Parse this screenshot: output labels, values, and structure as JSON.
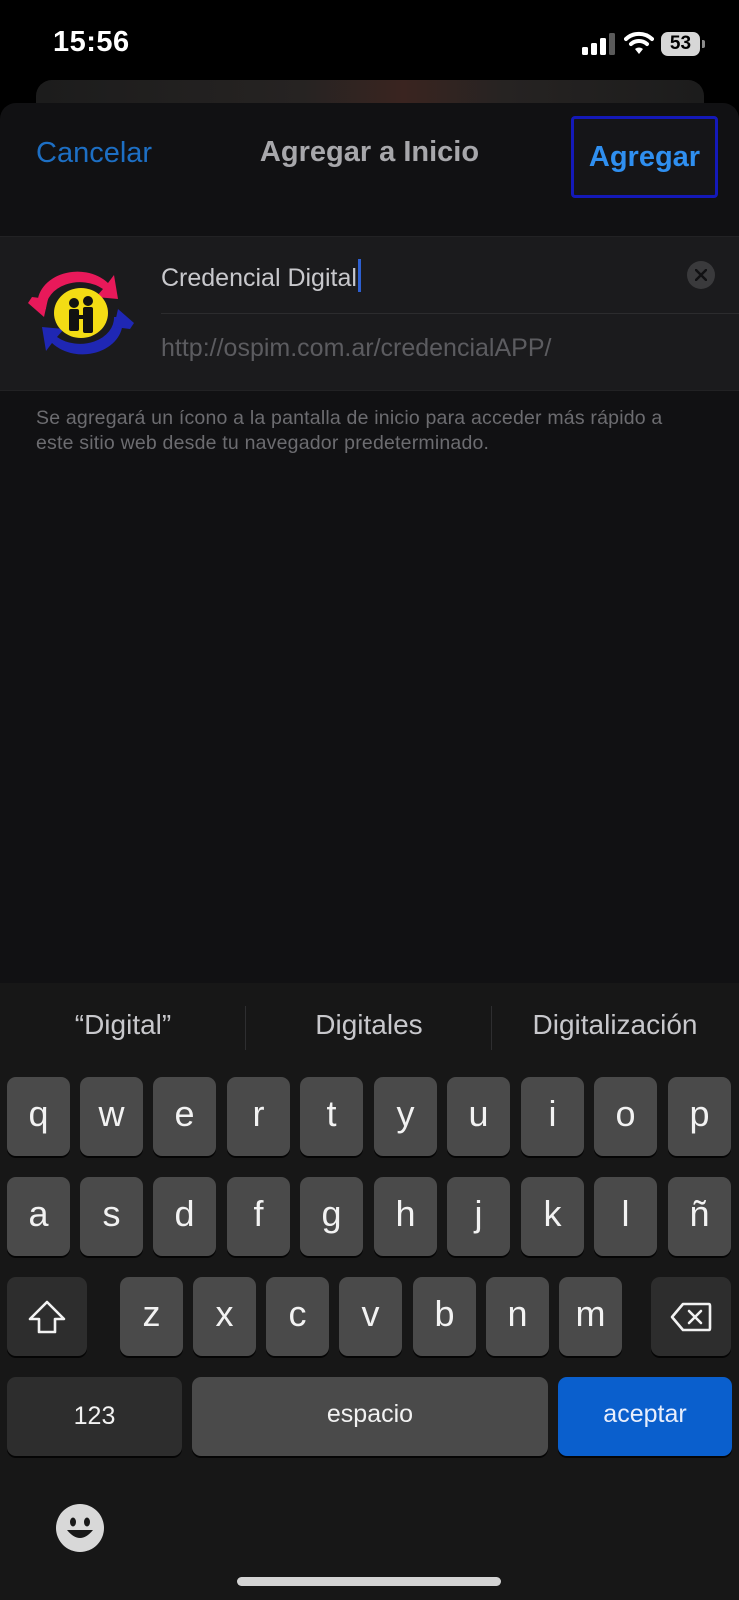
{
  "status_bar": {
    "time": "15:56",
    "battery": "53"
  },
  "nav": {
    "cancel": "Cancelar",
    "title": "Agregar a Inicio",
    "add": "Agregar"
  },
  "form": {
    "name_value": "Credencial Digital",
    "url": "http://ospim.com.ar/credencialAPP/"
  },
  "info": "Se agregará un ícono a la pantalla de inicio para acceder más rápido a este sitio web desde tu navegador predeterminado.",
  "keyboard": {
    "suggestions": [
      "“Digital”",
      "Digitales",
      "Digitalización"
    ],
    "row1": [
      "q",
      "w",
      "e",
      "r",
      "t",
      "y",
      "u",
      "i",
      "o",
      "p"
    ],
    "row2": [
      "a",
      "s",
      "d",
      "f",
      "g",
      "h",
      "j",
      "k",
      "l",
      "ñ"
    ],
    "row3": [
      "z",
      "x",
      "c",
      "v",
      "b",
      "n",
      "m"
    ],
    "numbers": "123",
    "space": "espacio",
    "accept": "aceptar"
  },
  "colors": {
    "accent": "#2f8ff0",
    "accept_key": "#0a5fcd",
    "focus_ring": "#1419b8"
  },
  "icons": [
    "cellular-signal-icon",
    "wifi-icon",
    "battery-icon",
    "clear-icon",
    "shift-icon",
    "delete-icon",
    "emoji-icon",
    "app-logo-icon"
  ]
}
